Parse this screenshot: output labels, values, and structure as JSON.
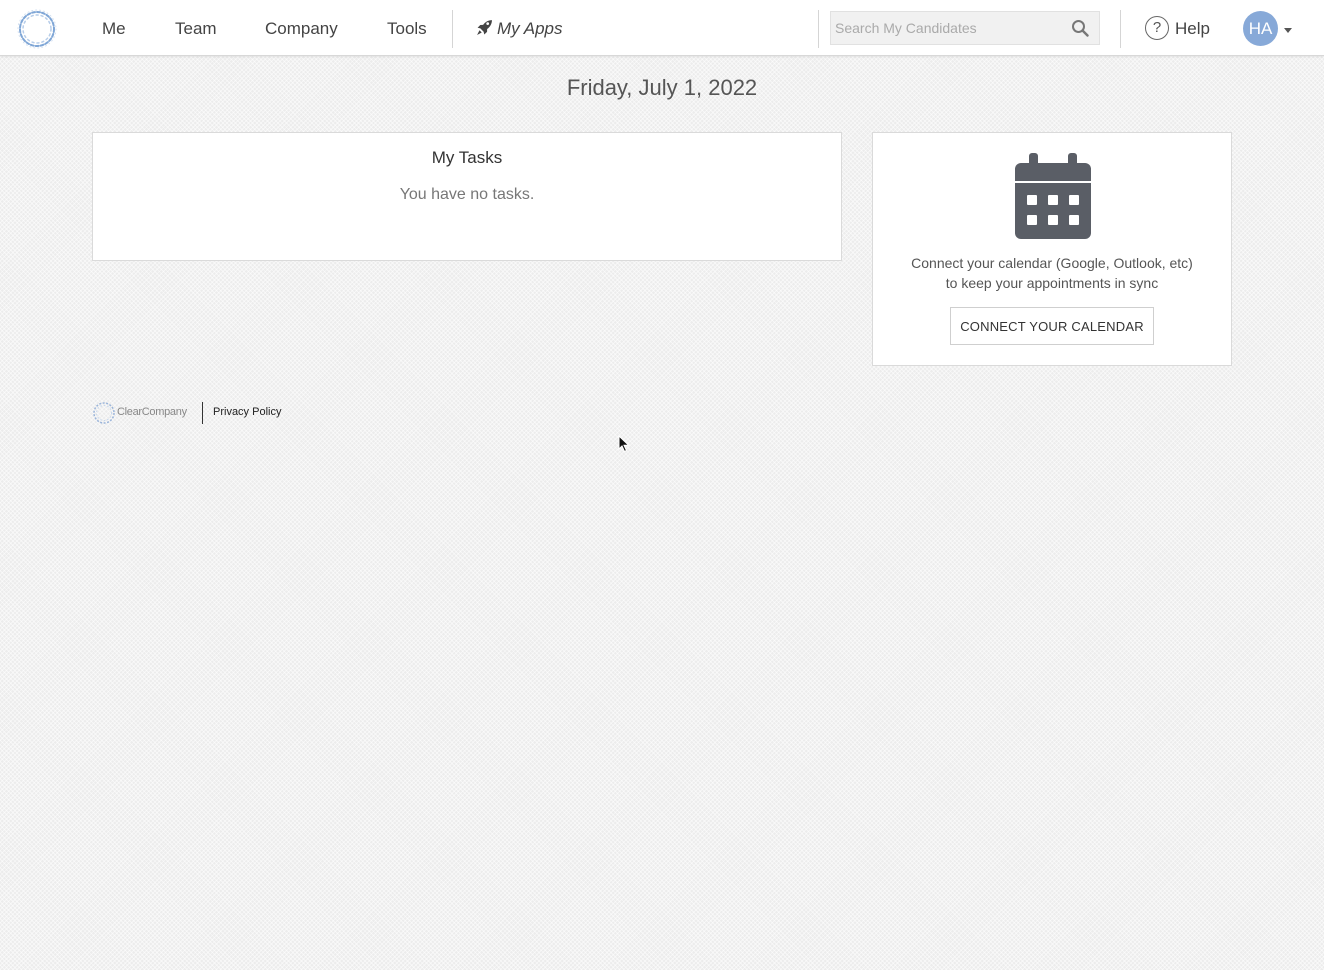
{
  "nav": {
    "items": [
      {
        "label": "Me"
      },
      {
        "label": "Team"
      },
      {
        "label": "Company"
      },
      {
        "label": "Tools"
      }
    ],
    "apps": {
      "label": "My Apps",
      "icon": "rocket-icon"
    },
    "search": {
      "placeholder": "Search My Candidates",
      "value": ""
    },
    "help": {
      "label": "Help",
      "icon_glyph": "?"
    },
    "user": {
      "initials": "HA"
    }
  },
  "page": {
    "date": "Friday, July 1, 2022"
  },
  "tasks": {
    "title": "My Tasks",
    "empty_text": "You have no tasks."
  },
  "calendar": {
    "icon": "calendar-icon",
    "description_line1": "Connect your calendar (Google, Outlook, etc)",
    "description_line2": "to keep your appointments in sync",
    "button_label": "CONNECT YOUR CALENDAR"
  },
  "footer": {
    "brand": "ClearCompany",
    "privacy_label": "Privacy Policy"
  },
  "colors": {
    "accent": "#87a9d8",
    "calendar_icon": "#5a5e66"
  }
}
